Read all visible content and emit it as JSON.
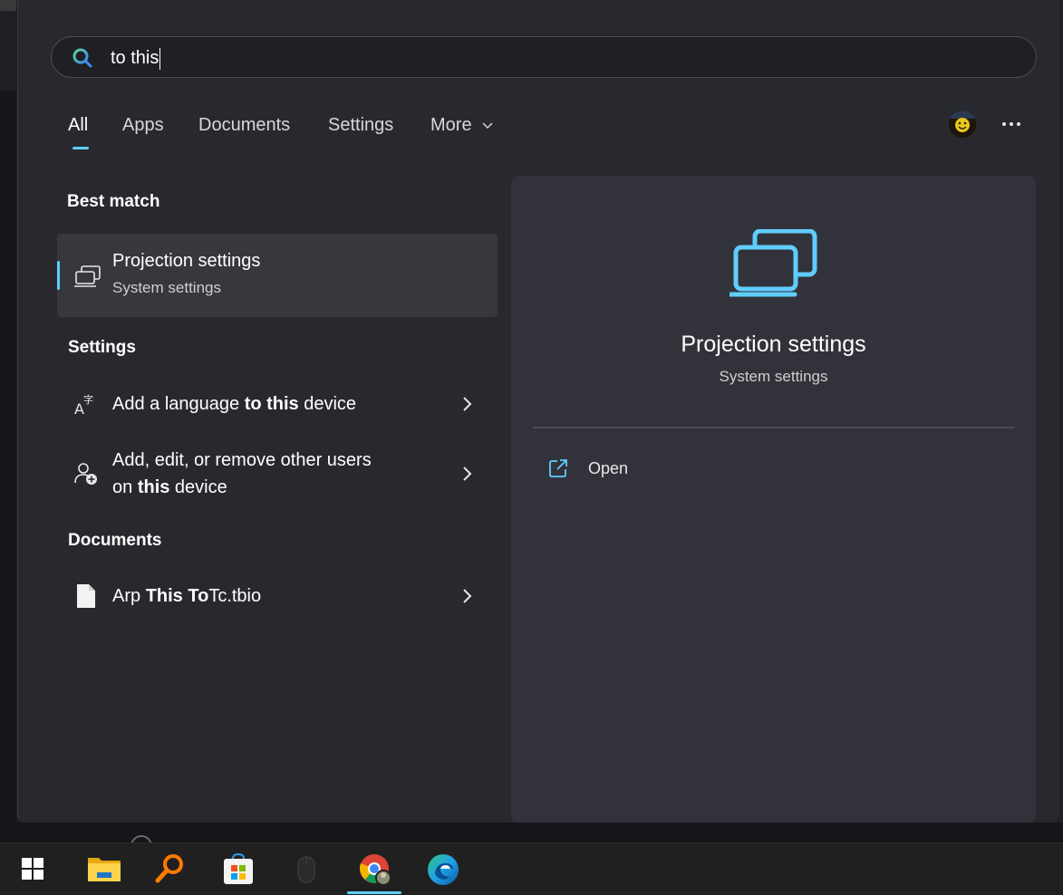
{
  "search": {
    "query": "to this"
  },
  "tabs": [
    {
      "label": "All",
      "active": true
    },
    {
      "label": "Apps"
    },
    {
      "label": "Documents"
    },
    {
      "label": "Settings"
    },
    {
      "label": "More"
    }
  ],
  "sections": {
    "best_match": "Best match",
    "settings": "Settings",
    "documents": "Documents"
  },
  "best_match": {
    "title": "Projection settings",
    "subtitle": "System settings",
    "icon": "projection-icon"
  },
  "settings_items": [
    {
      "pre": "Add a language ",
      "bold": "to this",
      "post": " device",
      "icon": "language-icon"
    },
    {
      "line1": "Add, edit, or remove other users",
      "pre2": "on ",
      "bold2": "this",
      "post2": " device",
      "icon": "user-add-icon"
    }
  ],
  "document_items": [
    {
      "pre": "Arp ",
      "bold": "This To",
      "post": "Tc.tbio",
      "icon": "document-icon"
    }
  ],
  "preview": {
    "title": "Projection settings",
    "subtitle": "System settings",
    "open_label": "Open"
  },
  "taskbar": {
    "apps": [
      "start-icon",
      "file-explorer-icon",
      "search-app-icon",
      "microsoft-store-icon",
      "mouse-app-icon",
      "chrome-icon",
      "edge-icon"
    ],
    "accent": "#60cdff"
  },
  "colors": {
    "accent": "#60cdff",
    "panel": "#28292e",
    "preview": "#32333a"
  }
}
